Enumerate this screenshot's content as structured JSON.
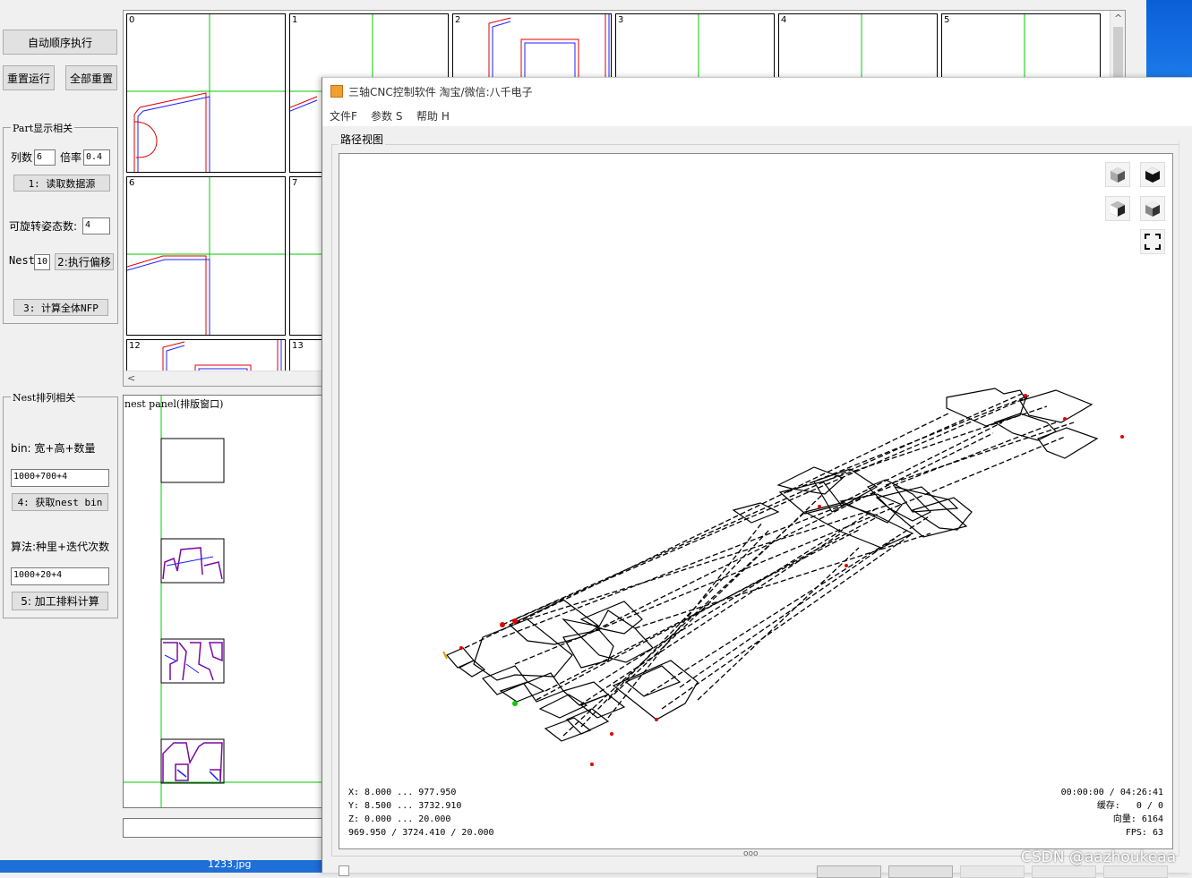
{
  "left_panel": {
    "auto_exec_btn": "自动顺序执行",
    "rerun_btn": "重置运行",
    "reset_all_btn": "全部重置",
    "part_group": {
      "title": "Part显示相关",
      "cols_label": "列数",
      "cols_value": "6",
      "scale_label": "倍率",
      "scale_value": "0.4",
      "read_btn": "1: 读取数据源",
      "rot_label": "可旋转姿态数:",
      "rot_value": "4",
      "nest_label": "Nest",
      "nest_value": "10",
      "offset_btn": "2:执行偏移",
      "nfp_btn": "3: 计算全体NFP"
    },
    "nest_group": {
      "title": "Nest排列相关",
      "bin_label": "bin: 宽+高+数量",
      "bin_value": "1000+700+4",
      "get_bin_btn": "4: 获取nest bin",
      "algo_label": "算法:种里+迭代次数",
      "algo_value": "1000+20+4",
      "compute_btn": "5: 加工排料计算"
    }
  },
  "part_grid": {
    "indices": [
      "0",
      "1",
      "2",
      "3",
      "4",
      "5",
      "6",
      "7",
      "12",
      "13"
    ],
    "scroll_left": "<",
    "scroll_up": "^"
  },
  "nest_panel": {
    "title": "nest panel(排版窗口)"
  },
  "taskbar_file": "1233.jpg",
  "cnc_window": {
    "title": "三轴CNC控制软件 淘宝/微信:八千电子",
    "menu": [
      "文件F",
      "参数 S",
      "帮助 H"
    ],
    "path_view_label": "路径视图",
    "stats_left": {
      "x": "X: 8.000 ... 977.950",
      "y": "Y: 8.500 ... 3732.910",
      "z": "Z: 0.000 ... 20.000",
      "total": "969.950 / 3724.410 / 20.000"
    },
    "stats_right": {
      "time": "00:00:00 / 04:26:41",
      "cache": "缓存:   0 / 0",
      "vectors": "向量: 6164",
      "fps": "FPS: 63"
    },
    "splitter_dots": "ooo"
  },
  "watermark": "CSDN @aazhoukeaa",
  "colors": {
    "accent_green": "#00cc00",
    "path_red": "#e00000",
    "path_blue": "#2020ff"
  }
}
